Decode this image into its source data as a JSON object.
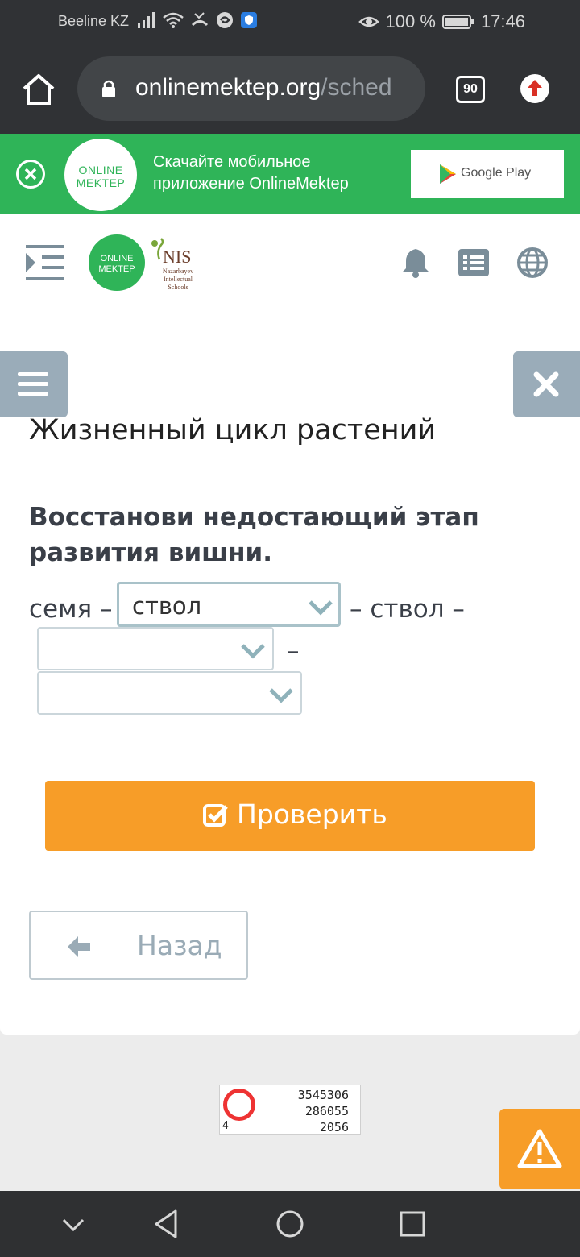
{
  "status_bar": {
    "carrier": "Beeline KZ",
    "battery": "100 %",
    "time": "17:46",
    "icons": [
      "signal-icon",
      "wifi-icon",
      "missed-call-icon",
      "sync-icon",
      "shield-icon",
      "eye-comfort-icon",
      "battery-icon"
    ]
  },
  "browser": {
    "url_main": "onlinemektep.org",
    "url_rest": "/sched",
    "tab_count": "90"
  },
  "banner": {
    "logo_line1": "ONLINE",
    "logo_line2": "MEKTEP",
    "text": "Скачайте мобильное приложение OnlineMektep",
    "store_label": "Google Play"
  },
  "header": {
    "logo_line1": "ONLINE",
    "logo_line2": "MEKTEP",
    "nis_title": "NIS",
    "nis_subtitle": "Nazarbayev Intellectual Schools"
  },
  "lesson": {
    "title": "Жизненный цикл растений",
    "task": "Восстанови недостающий этап развития вишни.",
    "seq_start": "семя –",
    "seq_middle": "– ствол –",
    "seq_dash": "–",
    "select1_value": "ствол",
    "select2_value": "",
    "select3_value": "",
    "check_label": "Проверить",
    "back_label": "Назад"
  },
  "counter": {
    "line1": "3545306",
    "line2": "286055",
    "line3": "2056",
    "badge": "4"
  },
  "colors": {
    "green": "#2fb458",
    "orange": "#f79d28",
    "side_button": "#9aacb9",
    "chrome_dark": "#303235"
  }
}
